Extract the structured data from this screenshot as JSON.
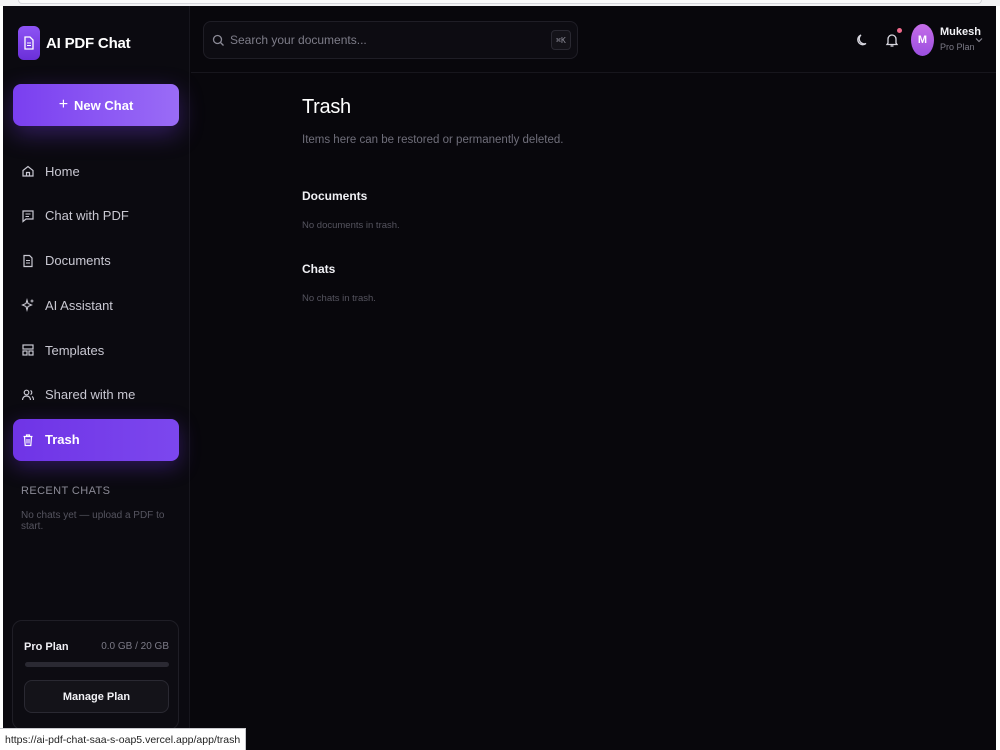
{
  "brand": {
    "name": "AI PDF Chat",
    "icon": "document-icon"
  },
  "sidebar": {
    "new_chat_label": "New Chat",
    "items": [
      {
        "label": "Home",
        "icon": "home-icon",
        "active": false
      },
      {
        "label": "Chat with PDF",
        "icon": "chat-icon",
        "active": false
      },
      {
        "label": "Documents",
        "icon": "document-icon",
        "active": false
      },
      {
        "label": "AI Assistant",
        "icon": "sparkles-icon",
        "active": false
      },
      {
        "label": "Templates",
        "icon": "templates-icon",
        "active": false
      },
      {
        "label": "Shared with me",
        "icon": "users-icon",
        "active": false
      },
      {
        "label": "Trash",
        "icon": "trash-icon",
        "active": true
      }
    ],
    "recent_title": "RECENT CHATS",
    "recent_empty": "No chats yet — upload a PDF to start.",
    "plan": {
      "name": "Pro Plan",
      "usage": "0.0 GB / 20 GB",
      "usage_fraction": 0,
      "manage_label": "Manage Plan"
    }
  },
  "header": {
    "search_placeholder": "Search your documents...",
    "shortcut": "⌘K",
    "user": {
      "initial": "M",
      "name": "Mukesh",
      "plan": "Pro Plan"
    },
    "has_notification": true
  },
  "main": {
    "title": "Trash",
    "subtitle": "Items here can be restored or permanently deleted.",
    "sections": [
      {
        "title": "Documents",
        "empty": "No documents in trash."
      },
      {
        "title": "Chats",
        "empty": "No chats in trash."
      }
    ]
  },
  "status_url": "https://ai-pdf-chat-saa-s-oap5.vercel.app/app/trash",
  "colors": {
    "accent": "#7a3ff0",
    "background": "#08070c",
    "sidebar": "#0b0a10",
    "notification": "#f06a8c"
  }
}
